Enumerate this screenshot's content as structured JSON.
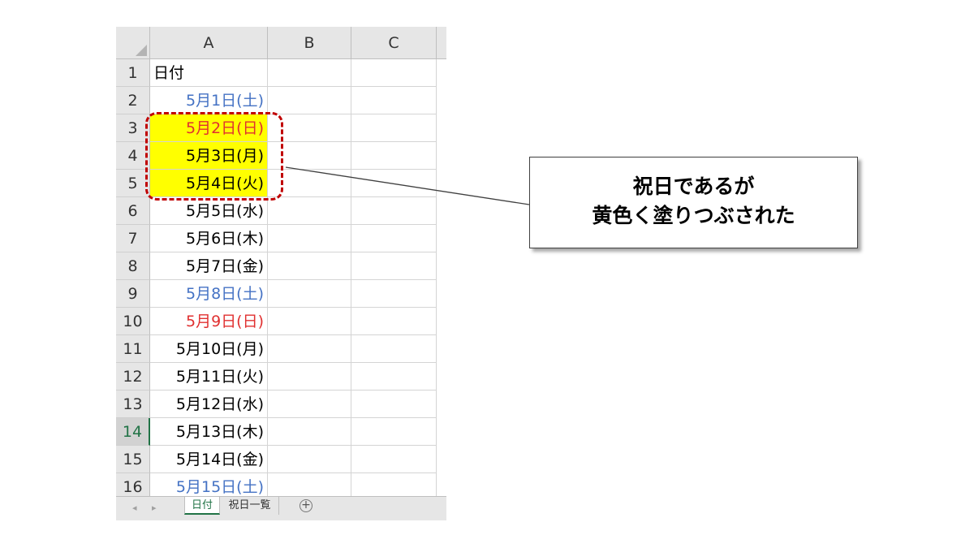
{
  "sheet": {
    "select_all_label": "",
    "columns": [
      "A",
      "B",
      "C"
    ],
    "rows": [
      {
        "num": "1",
        "a": "日付",
        "color": "#000000",
        "highlight": false,
        "align": "left",
        "active": false
      },
      {
        "num": "2",
        "a": "5月1日(土)",
        "color": "#4472c4",
        "highlight": false,
        "align": "right",
        "active": false
      },
      {
        "num": "3",
        "a": "5月2日(日)",
        "color": "#e03030",
        "highlight": true,
        "align": "right",
        "active": false
      },
      {
        "num": "4",
        "a": "5月3日(月)",
        "color": "#000000",
        "highlight": true,
        "align": "right",
        "active": false
      },
      {
        "num": "5",
        "a": "5月4日(火)",
        "color": "#000000",
        "highlight": true,
        "align": "right",
        "active": false
      },
      {
        "num": "6",
        "a": "5月5日(水)",
        "color": "#000000",
        "highlight": false,
        "align": "right",
        "active": false
      },
      {
        "num": "7",
        "a": "5月6日(木)",
        "color": "#000000",
        "highlight": false,
        "align": "right",
        "active": false
      },
      {
        "num": "8",
        "a": "5月7日(金)",
        "color": "#000000",
        "highlight": false,
        "align": "right",
        "active": false
      },
      {
        "num": "9",
        "a": "5月8日(土)",
        "color": "#4472c4",
        "highlight": false,
        "align": "right",
        "active": false
      },
      {
        "num": "10",
        "a": "5月9日(日)",
        "color": "#e03030",
        "highlight": false,
        "align": "right",
        "active": false
      },
      {
        "num": "11",
        "a": "5月10日(月)",
        "color": "#000000",
        "highlight": false,
        "align": "right",
        "active": false
      },
      {
        "num": "12",
        "a": "5月11日(火)",
        "color": "#000000",
        "highlight": false,
        "align": "right",
        "active": false
      },
      {
        "num": "13",
        "a": "5月12日(水)",
        "color": "#000000",
        "highlight": false,
        "align": "right",
        "active": false
      },
      {
        "num": "14",
        "a": "5月13日(木)",
        "color": "#000000",
        "highlight": false,
        "align": "right",
        "active": true
      },
      {
        "num": "15",
        "a": "5月14日(金)",
        "color": "#000000",
        "highlight": false,
        "align": "right",
        "active": false
      },
      {
        "num": "16",
        "a": "5月15日(土)",
        "color": "#4472c4",
        "highlight": false,
        "align": "right",
        "active": false
      }
    ],
    "tabs": {
      "active": "日付",
      "inactive": "祝日一覧",
      "add": "+"
    },
    "nav": {
      "prev": "◂",
      "next": "▸"
    }
  },
  "callout": {
    "line1": "祝日であるが",
    "line2": "黄色く塗りつぶされた"
  },
  "colors": {
    "highlight_fill": "#ffff00",
    "dashed_border": "#c00000",
    "saturday": "#4472c4",
    "sunday_holiday": "#e03030",
    "excel_green": "#217346"
  }
}
